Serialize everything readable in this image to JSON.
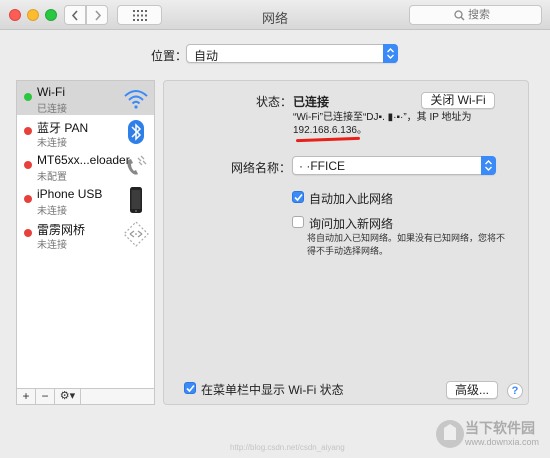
{
  "window": {
    "title": "网络",
    "search": {
      "placeholder": "搜索"
    }
  },
  "location": {
    "label": "位置：",
    "value": "自动"
  },
  "sidebar": {
    "items": [
      {
        "name": "Wi-Fi",
        "status": "已连接",
        "status_color": "#2bc73f",
        "icon": "wifi-icon"
      },
      {
        "name": "蓝牙 PAN",
        "status": "未连接",
        "status_color": "#e8403a",
        "icon": "bluetooth-icon"
      },
      {
        "name": "MT65xx...eloader",
        "status": "未配置",
        "status_color": "#e8403a",
        "icon": "phone-modem-icon"
      },
      {
        "name": "iPhone USB",
        "status": "未连接",
        "status_color": "#e8403a",
        "icon": "iphone-icon"
      },
      {
        "name": "雷雳网桥",
        "status": "未连接",
        "status_color": "#e8403a",
        "icon": "thunderbolt-bridge-icon"
      }
    ],
    "footer": {
      "add": "+",
      "remove": "−",
      "gear": "⚙︎▾"
    }
  },
  "detail": {
    "status_label": "状态：",
    "status_value": "已连接",
    "toggle_wifi_button": "关闭 Wi-Fi",
    "description_line1": "“Wi-Fi”已连接至“DJ▪. ▮·▪·”，其 IP 地址为",
    "description_line2": "192.168.6.136。",
    "network_name_label": "网络名称：",
    "network_name_value": "· ·FFICE",
    "auto_join": {
      "label": "自动加入此网络",
      "checked": true
    },
    "ask_join": {
      "label": "询问加入新网络",
      "checked": false
    },
    "ask_join_hint": "将自动加入已知网络。如果没有已知网络，您将不得不手动选择网络。"
  },
  "bottom": {
    "show_in_menubar": {
      "label": "在菜单栏中显示 Wi-Fi 状态",
      "checked": true
    },
    "advanced_button": "高级...",
    "help": "?"
  },
  "watermark": {
    "brand": "当下软件园",
    "url": "www.downxia.com",
    "blog": "http://blog.csdn.net/csdn_aiyang"
  },
  "colors": {
    "accent": "#3a8af7",
    "connected": "#2bc73f",
    "disconnected": "#e8403a"
  }
}
